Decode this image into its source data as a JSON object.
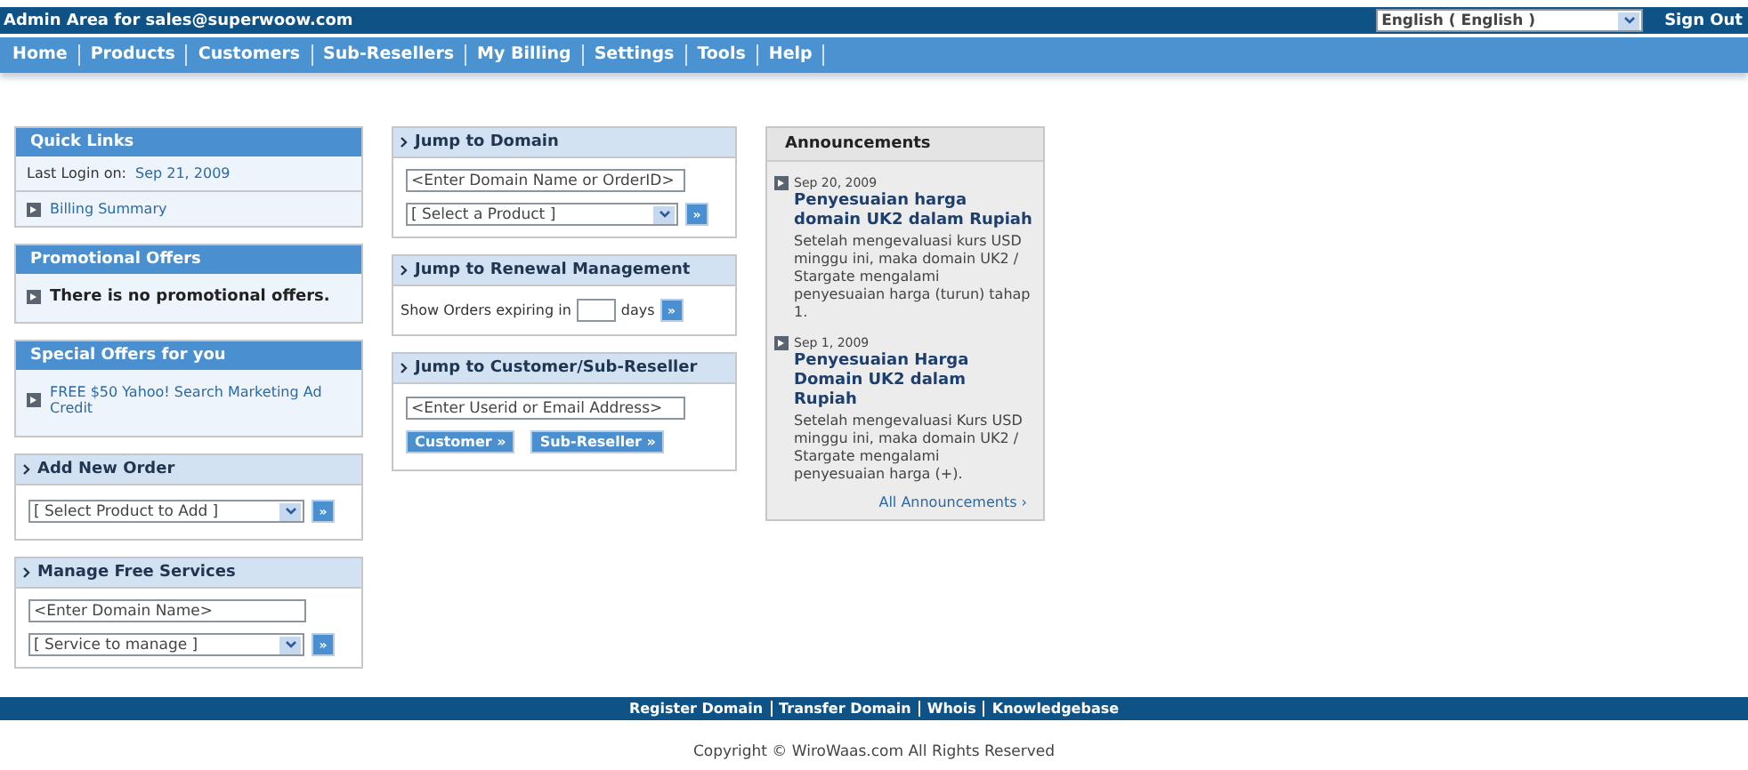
{
  "top_bar": {
    "title": "Admin Area for sales@superwoow.com",
    "language": "English ( English )",
    "sign_out": "Sign Out"
  },
  "nav": [
    "Home",
    "Products",
    "Customers",
    "Sub-Resellers",
    "My Billing",
    "Settings",
    "Tools",
    "Help"
  ],
  "quick_links": {
    "title": "Quick Links",
    "last_login_label": "Last Login on:",
    "last_login_date": "Sep 21, 2009",
    "items": [
      "Billing Summary"
    ]
  },
  "promotional_offers": {
    "title": "Promotional Offers",
    "text": "There is no promotional offers."
  },
  "special_offers": {
    "title": "Special Offers for you",
    "items": [
      "FREE $50 Yahoo! Search Marketing Ad Credit"
    ]
  },
  "add_new_order": {
    "title": "Add New Order",
    "select": "[ Select Product to Add ]",
    "go": "»"
  },
  "manage_free_services": {
    "title": "Manage Free Services",
    "input": "<Enter Domain Name>",
    "select": "[ Service to manage ]",
    "go": "»"
  },
  "jump_to_domain": {
    "title": "Jump to Domain",
    "input": "<Enter Domain Name or OrderID>",
    "select": "[ Select a Product ]",
    "go": "»"
  },
  "jump_to_renewal": {
    "title": "Jump to Renewal Management",
    "label": "Show Orders expiring in",
    "unit": "days",
    "go": "»"
  },
  "jump_to_customer": {
    "title": "Jump to Customer/Sub-Reseller",
    "input": "<Enter Userid or Email Address>",
    "buttons": [
      "Customer »",
      "Sub-Reseller »"
    ]
  },
  "announcements": {
    "title": "Announcements",
    "items": [
      {
        "date": "Sep 20, 2009",
        "title": "Penyesuaian harga domain UK2 dalam Rupiah",
        "body": "Setelah mengevaluasi kurs USD minggu ini, maka domain UK2 / Stargate mengalami penyesuaian harga (turun) tahap 1."
      },
      {
        "date": "Sep 1, 2009",
        "title": "Penyesuaian Harga Domain UK2 dalam Rupiah",
        "body": "Setelah mengevaluasi Kurs USD minggu ini, maka domain UK2 / Stargate mengalami penyesuaian harga (+)."
      }
    ],
    "all_link": "All Announcements ›"
  },
  "footer": {
    "links": [
      "Register Domain",
      "Transfer Domain",
      "Whois",
      "Knowledgebase"
    ],
    "copyright": "Copyright © WiroWaas.com All Rights Reserved"
  }
}
